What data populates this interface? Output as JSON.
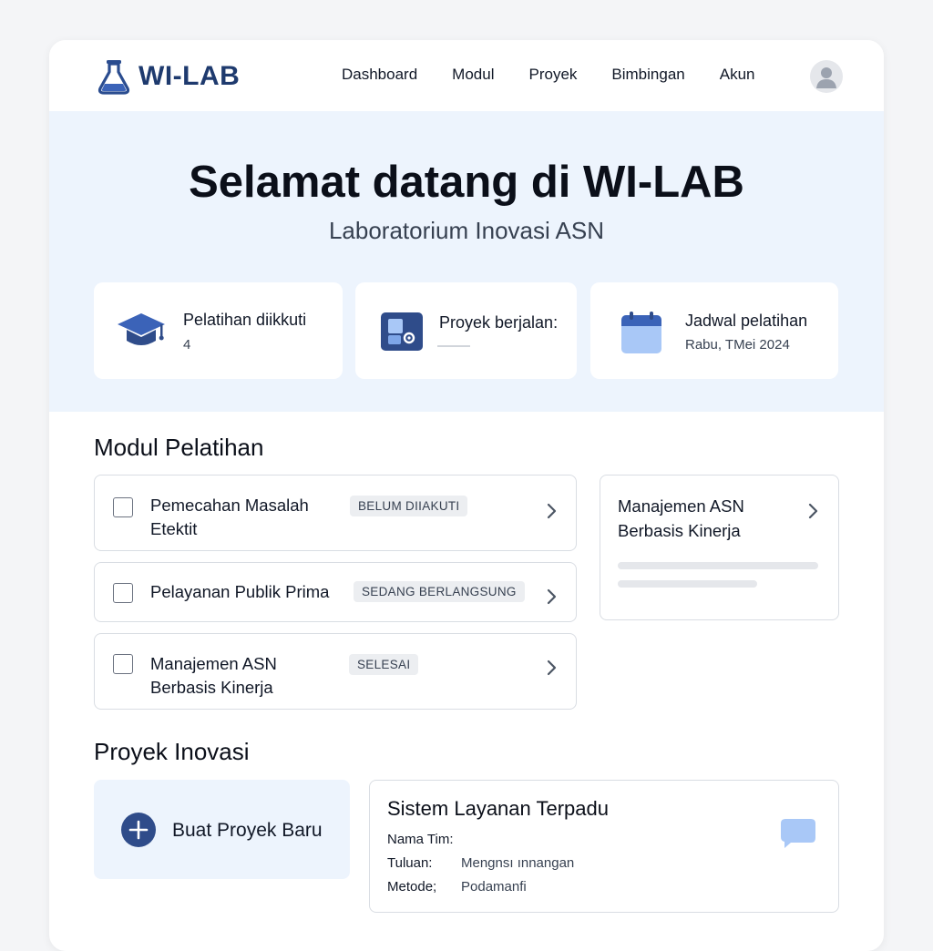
{
  "app": {
    "name": "WI-LAB",
    "logo_icon": "flask-icon"
  },
  "nav": {
    "items": [
      {
        "label": "Dashboard"
      },
      {
        "label": "Modul"
      },
      {
        "label": "Proyek"
      },
      {
        "label": "Bimbingan"
      },
      {
        "label": "Akun"
      }
    ],
    "avatar_icon": "user-avatar-icon"
  },
  "hero": {
    "title": "Selamat datang di WI-LAB",
    "subtitle": "Laboratorium Inovasi ASN"
  },
  "stats": [
    {
      "icon": "graduation-cap-icon",
      "label": "Pelatihan diikkuti",
      "value": "4"
    },
    {
      "icon": "project-gear-icon",
      "label": "Proyek berjalan:",
      "value": ""
    },
    {
      "icon": "calendar-icon",
      "label": "Jadwal pelatihan",
      "value": "Rabu, TMei 2024"
    }
  ],
  "modules": {
    "title": "Modul Pelatihan",
    "items": [
      {
        "title_line1": "Pemecahan Masalah",
        "title_line2": "Etektit",
        "status": "BELUM DIIAKUTI"
      },
      {
        "title_line1": "Pelayanan Publik Prima",
        "title_line2": "",
        "status": "SEDANG BERLANGSUNG"
      },
      {
        "title_line1": "Manajemen ASN",
        "title_line2": "Berbasis Kinerja",
        "status": "SELESAI"
      }
    ],
    "featured": {
      "title_line1": "Manajemen ASN",
      "title_line2": "Berbasis Kinerja"
    }
  },
  "projects": {
    "title": "Proyek Inovasi",
    "new_button": "Buat Proyek Baru",
    "card": {
      "title": "Sistem Layanan Terpadu",
      "fields": [
        {
          "key": "Nama Tim:",
          "value": ""
        },
        {
          "key": "Tuluan:",
          "value": "Mengnsı ınnangan"
        },
        {
          "key": "Metode;",
          "value": "Podamanfi"
        }
      ],
      "icon": "chat-bubble-icon"
    }
  },
  "colors": {
    "brand": "#1e3a6e",
    "hero_bg": "#edf4fd",
    "accent": "#3b63b8",
    "accent_light": "#a9c8f7"
  }
}
